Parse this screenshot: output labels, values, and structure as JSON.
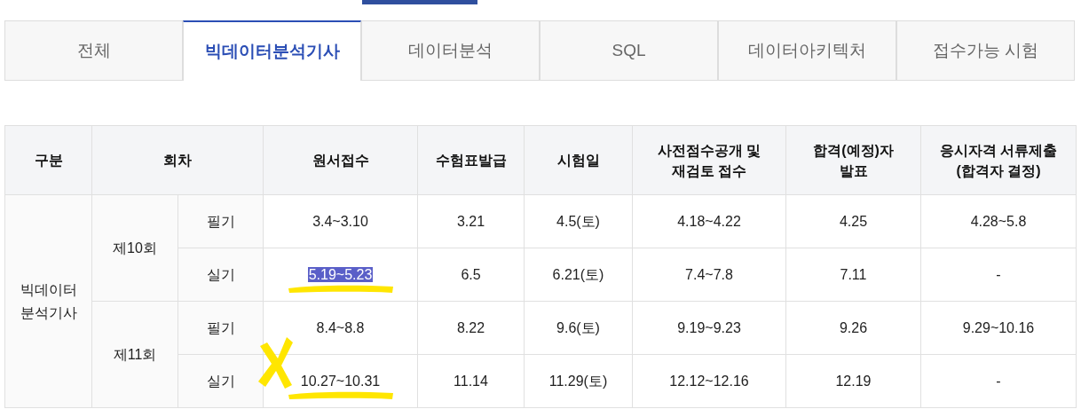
{
  "tabs": [
    {
      "label": "전체",
      "selected": false
    },
    {
      "label": "빅데이터분석기사",
      "selected": true
    },
    {
      "label": "데이터분석",
      "selected": false
    },
    {
      "label": "SQL",
      "selected": false
    },
    {
      "label": "데이터아키텍처",
      "selected": false
    },
    {
      "label": "접수가능 시험",
      "selected": false
    }
  ],
  "table": {
    "columns": [
      "구분",
      "회차",
      "원서접수",
      "수험표발급",
      "시험일",
      "사전점수공개 및\n재검토 접수",
      "합격(예정)자\n발표",
      "응시자격 서류제출\n(합격자 결정)"
    ],
    "category": "빅데이터 분석기사",
    "rounds": [
      {
        "label": "제10회",
        "rows": [
          {
            "type": "필기",
            "reception": {
              "text": "3.4~3.10",
              "highlighted": false,
              "underlined": false,
              "crossed": false
            },
            "cells": [
              "3.21",
              "4.5(토)",
              "4.18~4.22",
              "4.25",
              "4.28~5.8"
            ]
          },
          {
            "type": "실기",
            "reception": {
              "text": "5.19~5.23",
              "highlighted": true,
              "underlined": true,
              "crossed": false
            },
            "cells": [
              "6.5",
              "6.21(토)",
              "7.4~7.8",
              "7.11",
              "-"
            ]
          }
        ]
      },
      {
        "label": "제11회",
        "rows": [
          {
            "type": "필기",
            "reception": {
              "text": "8.4~8.8",
              "highlighted": false,
              "underlined": false,
              "crossed": false
            },
            "cells": [
              "8.22",
              "9.6(토)",
              "9.19~9.23",
              "9.26",
              "9.29~10.16"
            ]
          },
          {
            "type": "실기",
            "reception": {
              "text": "10.27~10.31",
              "highlighted": false,
              "underlined": true,
              "crossed": true
            },
            "cells": [
              "11.14",
              "11.29(토)",
              "12.12~12.16",
              "12.19",
              "-"
            ]
          }
        ]
      }
    ]
  }
}
